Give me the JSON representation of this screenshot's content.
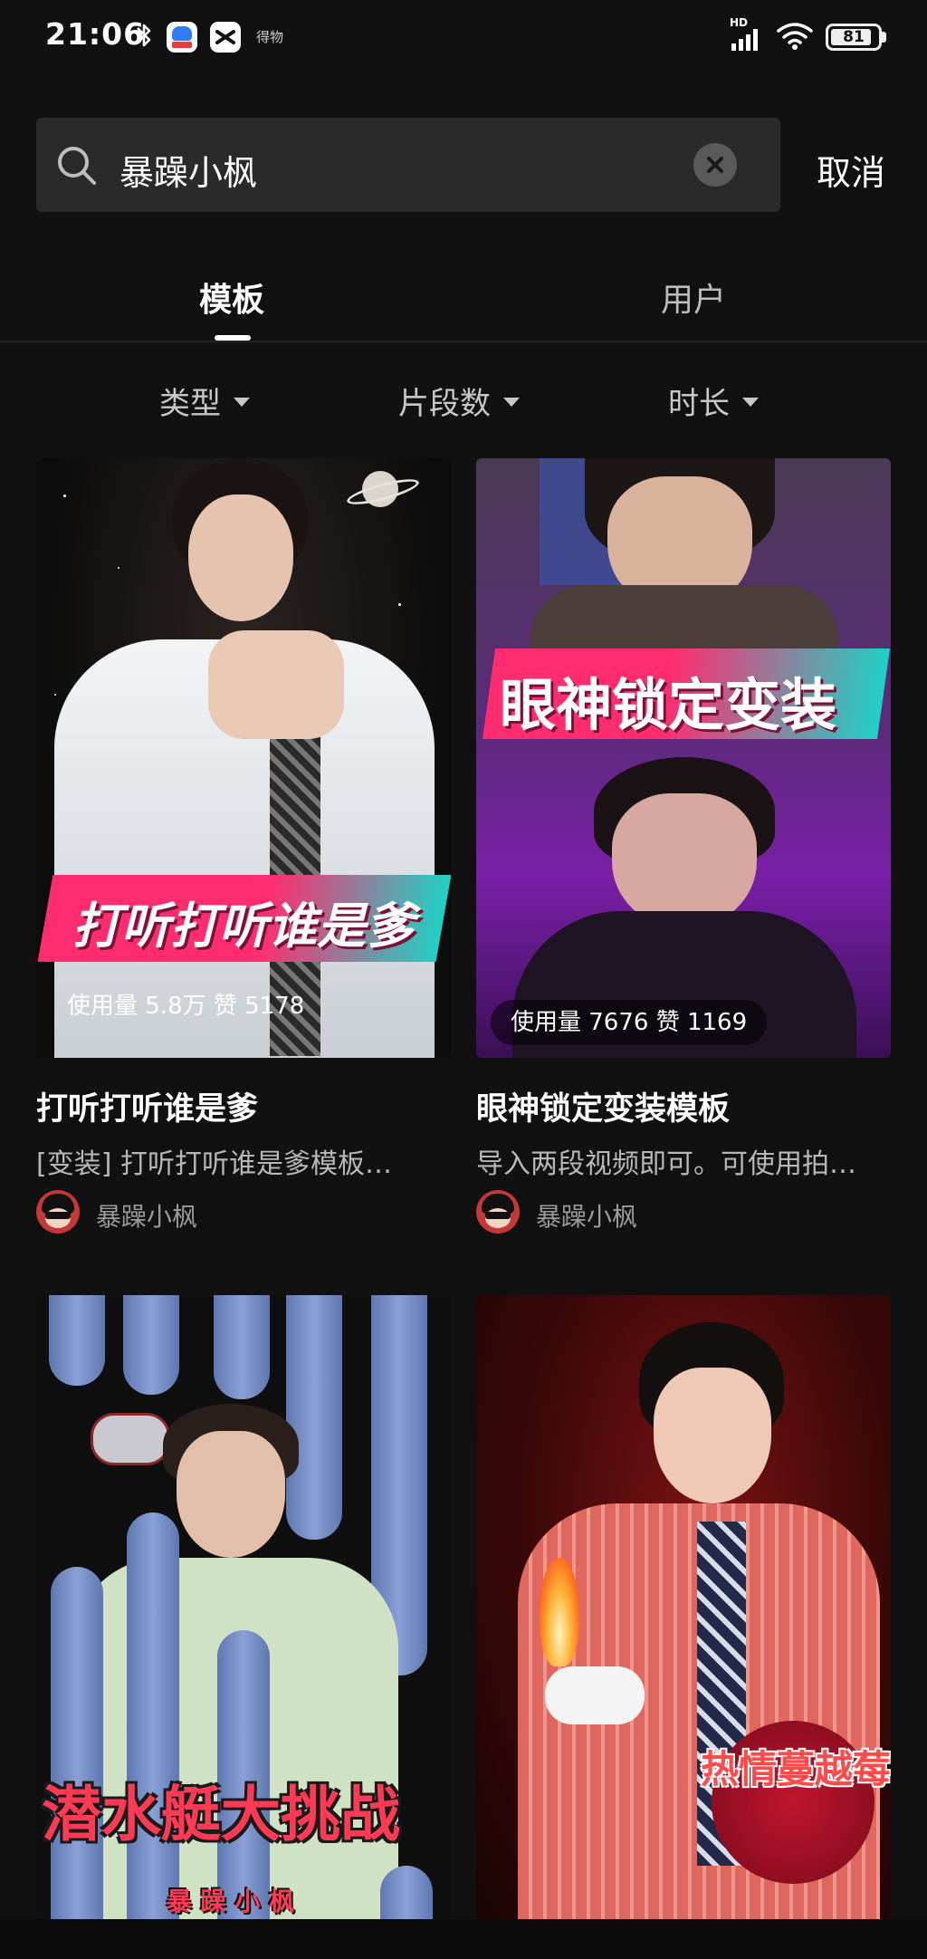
{
  "status_bar": {
    "time": "21:06",
    "small_label": "得物",
    "network": "HD",
    "battery": "81"
  },
  "search": {
    "query": "暴躁小枫",
    "cancel_label": "取消"
  },
  "tabs": [
    {
      "label": "模板",
      "active": true
    },
    {
      "label": "用户",
      "active": false
    }
  ],
  "filters": [
    {
      "label": "类型"
    },
    {
      "label": "片段数"
    },
    {
      "label": "时长"
    }
  ],
  "cards": [
    {
      "banner": "打听打听谁是爹",
      "stats": "使用量 5.8万 赞 5178",
      "title": "打听打听谁是爹",
      "desc": "[变装] 打听打听谁是爹模板…",
      "author": "暴躁小枫"
    },
    {
      "banner": "眼神锁定变装",
      "stats": "使用量 7676 赞 1169",
      "title": "眼神锁定变装模板",
      "desc": "导入两段视频即可。可使用拍…",
      "author": "暴躁小枫"
    },
    {
      "banner": "潜水艇大挑战",
      "banner_sub": "暴 躁 小 枫"
    },
    {
      "banner": "热情蔓越莓"
    }
  ],
  "colors": {
    "background": "#111111",
    "accent_cyan": "#1fd1c6",
    "accent_pink": "#ff2d6f"
  }
}
